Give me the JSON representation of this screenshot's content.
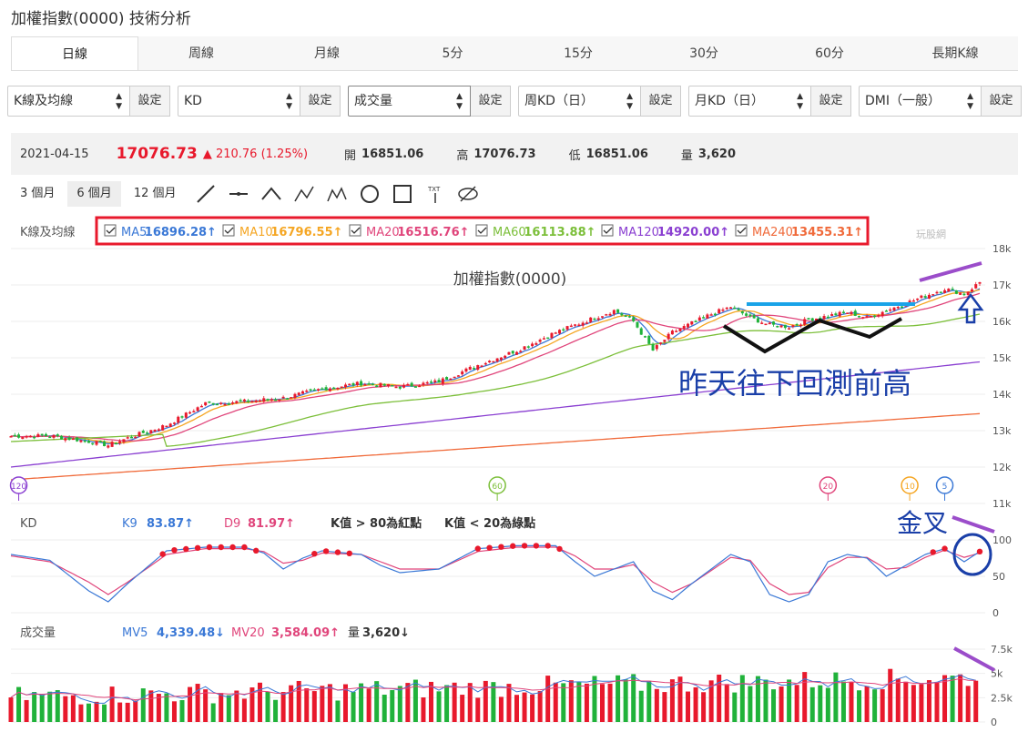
{
  "page_title": "加權指數(0000) 技術分析",
  "tabs": [
    "日線",
    "周線",
    "月線",
    "5分",
    "15分",
    "30分",
    "60分",
    "長期K線"
  ],
  "selectors": [
    {
      "value": "K線及均線",
      "btn": "設定"
    },
    {
      "value": "KD",
      "btn": "設定"
    },
    {
      "value": "成交量",
      "btn": "設定"
    },
    {
      "value": "周KD（日）",
      "btn": "設定"
    },
    {
      "value": "月KD（日）",
      "btn": "設定"
    },
    {
      "value": "DMI（一般）",
      "btn": "設定"
    }
  ],
  "quote": {
    "date": "2021-04-15",
    "price": "17076.73",
    "change": "▲ 210.76 (1.25%)",
    "open_label": "開",
    "open": "16851.06",
    "high_label": "高",
    "high": "17076.73",
    "low_label": "低",
    "low": "16851.06",
    "vol_label": "量",
    "vol": "3,620"
  },
  "ranges": [
    "3 個月",
    "6 個月",
    "12 個月"
  ],
  "ma_panel": {
    "label": "K線及均線",
    "items": [
      {
        "name": "MA5",
        "value": "16896.28↑",
        "color": "#3a78d6"
      },
      {
        "name": "MA10",
        "value": "16796.55↑",
        "color": "#f5a623"
      },
      {
        "name": "MA20",
        "value": "16516.76↑",
        "color": "#e0457b"
      },
      {
        "name": "MA60",
        "value": "16113.88↑",
        "color": "#7cbf3a"
      },
      {
        "name": "MA120",
        "value": "14920.00↑",
        "color": "#8a3fd1"
      },
      {
        "name": "MA240",
        "value": "13455.31↑",
        "color": "#f06a3a"
      }
    ],
    "watermark": "玩股網"
  },
  "kd_panel": {
    "label": "KD",
    "k": {
      "name": "K9",
      "value": "83.87↑",
      "color": "#3a78d6"
    },
    "d": {
      "name": "D9",
      "value": "81.97↑",
      "color": "#e0457b"
    },
    "note1": "K值 > 80為紅點",
    "note2": "K值 < 20為綠點"
  },
  "vol_panel": {
    "label": "成交量",
    "mv5": {
      "name": "MV5",
      "value": "4,339.48↓",
      "color": "#3a78d6"
    },
    "mv20": {
      "name": "MV20",
      "value": "3,584.09↑",
      "color": "#e0457b"
    },
    "vol": {
      "name": "量",
      "value": "3,620↓"
    }
  },
  "annotations": {
    "retest": "昨天往下回測前高",
    "golden_cross": "金叉"
  },
  "colors": {
    "up": "#e8192c",
    "down": "#20b23a",
    "accent_red": "#e8192c",
    "annot_blue": "#1a3fa8",
    "annot_purple": "#9b4dca"
  },
  "chart_data": [
    {
      "type": "candlestick",
      "title": "加權指數(0000)",
      "ylim": [
        11000,
        18000
      ],
      "yticks": [
        "18k",
        "17k",
        "16k",
        "15k",
        "14k",
        "13k",
        "12k",
        "11k"
      ],
      "ma_markers": [
        "120",
        "60",
        "20",
        "10",
        "5"
      ],
      "close_anchors": [
        [
          0,
          12850
        ],
        [
          10,
          12860
        ],
        [
          20,
          12700
        ],
        [
          25,
          12600
        ],
        [
          30,
          12800
        ],
        [
          40,
          13150
        ],
        [
          50,
          13750
        ],
        [
          60,
          13800
        ],
        [
          70,
          13900
        ],
        [
          80,
          14150
        ],
        [
          90,
          14300
        ],
        [
          100,
          14200
        ],
        [
          110,
          14350
        ],
        [
          120,
          14800
        ],
        [
          130,
          15200
        ],
        [
          140,
          15700
        ],
        [
          150,
          16100
        ],
        [
          155,
          16300
        ],
        [
          160,
          16000
        ],
        [
          165,
          15200
        ],
        [
          170,
          15700
        ],
        [
          180,
          16200
        ],
        [
          185,
          16400
        ],
        [
          190,
          16100
        ],
        [
          195,
          15900
        ],
        [
          200,
          15850
        ],
        [
          205,
          16050
        ],
        [
          210,
          16150
        ],
        [
          215,
          16250
        ],
        [
          220,
          16100
        ],
        [
          225,
          16300
        ],
        [
          230,
          16500
        ],
        [
          235,
          16700
        ],
        [
          240,
          16900
        ],
        [
          245,
          16750
        ],
        [
          249,
          17076
        ]
      ]
    },
    {
      "type": "line",
      "name": "KD",
      "ylim": [
        0,
        100
      ],
      "yticks": [
        "100",
        "50",
        "0"
      ],
      "k_anchors": [
        [
          0,
          80
        ],
        [
          10,
          72
        ],
        [
          20,
          30
        ],
        [
          25,
          15
        ],
        [
          30,
          40
        ],
        [
          40,
          85
        ],
        [
          50,
          90
        ],
        [
          60,
          90
        ],
        [
          65,
          82
        ],
        [
          70,
          60
        ],
        [
          75,
          75
        ],
        [
          80,
          85
        ],
        [
          90,
          80
        ],
        [
          95,
          65
        ],
        [
          100,
          55
        ],
        [
          110,
          60
        ],
        [
          120,
          88
        ],
        [
          130,
          92
        ],
        [
          140,
          92
        ],
        [
          145,
          70
        ],
        [
          150,
          50
        ],
        [
          155,
          60
        ],
        [
          160,
          70
        ],
        [
          165,
          30
        ],
        [
          170,
          18
        ],
        [
          175,
          40
        ],
        [
          180,
          60
        ],
        [
          185,
          80
        ],
        [
          190,
          70
        ],
        [
          195,
          25
        ],
        [
          200,
          15
        ],
        [
          205,
          25
        ],
        [
          210,
          70
        ],
        [
          215,
          80
        ],
        [
          220,
          75
        ],
        [
          225,
          50
        ],
        [
          230,
          65
        ],
        [
          235,
          80
        ],
        [
          240,
          88
        ],
        [
          245,
          70
        ],
        [
          249,
          84
        ]
      ],
      "d_anchors": [
        [
          0,
          78
        ],
        [
          10,
          70
        ],
        [
          20,
          42
        ],
        [
          25,
          25
        ],
        [
          30,
          42
        ],
        [
          40,
          80
        ],
        [
          50,
          88
        ],
        [
          60,
          88
        ],
        [
          65,
          84
        ],
        [
          70,
          68
        ],
        [
          75,
          72
        ],
        [
          80,
          82
        ],
        [
          90,
          80
        ],
        [
          95,
          70
        ],
        [
          100,
          60
        ],
        [
          110,
          60
        ],
        [
          120,
          84
        ],
        [
          130,
          90
        ],
        [
          140,
          90
        ],
        [
          145,
          78
        ],
        [
          150,
          60
        ],
        [
          155,
          60
        ],
        [
          160,
          66
        ],
        [
          165,
          42
        ],
        [
          170,
          28
        ],
        [
          175,
          40
        ],
        [
          180,
          58
        ],
        [
          185,
          76
        ],
        [
          190,
          72
        ],
        [
          195,
          40
        ],
        [
          200,
          25
        ],
        [
          205,
          28
        ],
        [
          210,
          62
        ],
        [
          215,
          76
        ],
        [
          220,
          76
        ],
        [
          225,
          60
        ],
        [
          230,
          62
        ],
        [
          235,
          76
        ],
        [
          240,
          86
        ],
        [
          245,
          76
        ],
        [
          249,
          82
        ]
      ]
    },
    {
      "type": "bar",
      "name": "成交量",
      "ylim": [
        0,
        7500
      ],
      "yticks": [
        "7.5k",
        "5k",
        "2.5k",
        "0"
      ]
    }
  ]
}
